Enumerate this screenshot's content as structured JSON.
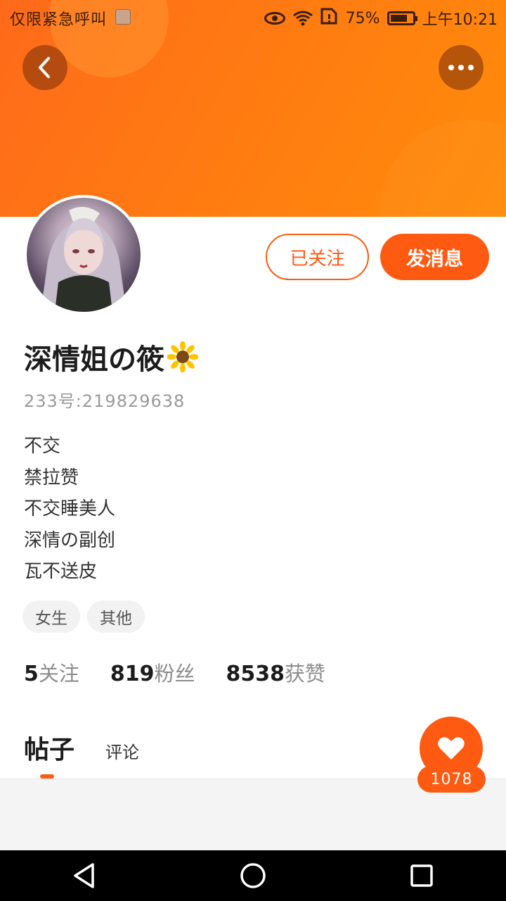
{
  "status_bar": {
    "left_text": "仅限紧急呼叫",
    "battery_percent": "75%",
    "time": "上午10:21",
    "battery_level": 0.75,
    "icons": [
      "image-icon",
      "eye-icon",
      "wifi-icon",
      "sim-icon",
      "battery-icon"
    ]
  },
  "header": {
    "back_icon": "chevron-left-icon",
    "more_icon": "more-dots-icon",
    "banner_color": "#ff7a12"
  },
  "profile": {
    "name": "深情姐の筱",
    "name_emoji": "sunflower-icon",
    "uid": "233号:219829638",
    "bio_lines": [
      "不交",
      "禁拉赞",
      "不交睡美人",
      "深情の副创",
      "瓦不送皮"
    ],
    "tags": [
      "女生",
      "其他"
    ]
  },
  "actions": {
    "follow_label": "已关注",
    "message_label": "发消息"
  },
  "stats": [
    {
      "value": "5",
      "label": "关注"
    },
    {
      "value": "819",
      "label": "粉丝"
    },
    {
      "value": "8538",
      "label": "获赞"
    }
  ],
  "tabs": {
    "posts": "帖子",
    "comments": "评论"
  },
  "like": {
    "count": "1078"
  },
  "colors": {
    "accent": "#ff5a12"
  }
}
